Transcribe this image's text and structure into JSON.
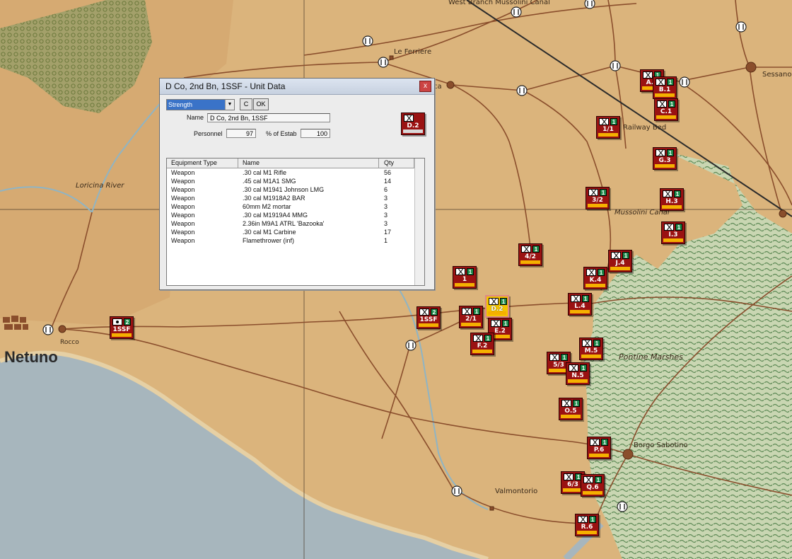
{
  "map": {
    "colors": {
      "land": "#dcb37a",
      "sea": "#a9b8c2",
      "marsh": "#c7d6b8",
      "road": "#8b4f2e",
      "river": "#8eb5c7",
      "forest": "#9aa36a"
    },
    "labels": {
      "west_branch": "West Branch Mussolini Canal",
      "le_ferriere": "Le Ferriere",
      "sessano": "Sessano",
      "railway_bed": "Railway Bed",
      "loricina": "Loricina River",
      "mussolini_canal": "Mussolini Canal",
      "pontine": "Pontine Marshes",
      "borgo": "Borgo Sabotino",
      "valmontorio": "Valmontorio",
      "rocco": "Rocco",
      "netuno": "Netuno",
      "cisterna_fragment": "ca"
    }
  },
  "units": [
    {
      "id": "a1",
      "label": "A.1",
      "num": "1",
      "icon": "infantry-icon"
    },
    {
      "id": "b1",
      "label": "B.1",
      "num": "1",
      "icon": "infantry-icon"
    },
    {
      "id": "c1",
      "label": "C.1",
      "num": "1",
      "icon": "infantry-icon"
    },
    {
      "id": "u1_1",
      "label": "1/1",
      "num": "1",
      "icon": "infantry-icon"
    },
    {
      "id": "g3",
      "label": "G.3",
      "num": "1",
      "icon": "infantry-icon"
    },
    {
      "id": "h3",
      "label": "H.3",
      "num": "1",
      "icon": "infantry-icon"
    },
    {
      "id": "u3_2",
      "label": "3/2",
      "num": "1",
      "icon": "infantry-icon"
    },
    {
      "id": "i3",
      "label": "I.3",
      "num": "1",
      "icon": "infantry-icon"
    },
    {
      "id": "u4_2",
      "label": "4/2",
      "num": "1",
      "icon": "infantry-icon"
    },
    {
      "id": "j4",
      "label": "J.4",
      "num": "1",
      "icon": "infantry-icon"
    },
    {
      "id": "k4",
      "label": "K.4",
      "num": "1",
      "icon": "infantry-icon"
    },
    {
      "id": "u1",
      "label": "1",
      "num": "1",
      "icon": "infantry-icon"
    },
    {
      "id": "l4",
      "label": "L.4",
      "num": "1",
      "icon": "infantry-icon"
    },
    {
      "id": "d2",
      "label": "D.2",
      "num": "1",
      "icon": "infantry-icon"
    },
    {
      "id": "s1ssf2",
      "label": "1SSF",
      "num": "2",
      "icon": "infantry-icon"
    },
    {
      "id": "u2_1",
      "label": "2/1",
      "num": "1",
      "icon": "infantry-icon"
    },
    {
      "id": "e2",
      "label": "E.2",
      "num": "1",
      "icon": "infantry-icon"
    },
    {
      "id": "f2",
      "label": "F.2",
      "num": "1",
      "icon": "infantry-icon"
    },
    {
      "id": "m5",
      "label": "M.5",
      "num": "1",
      "icon": "infantry-icon"
    },
    {
      "id": "u5_3",
      "label": "5/3",
      "num": "1",
      "icon": "infantry-icon"
    },
    {
      "id": "n5",
      "label": "N.5",
      "num": "1",
      "icon": "infantry-icon"
    },
    {
      "id": "o5",
      "label": "O.5",
      "num": "1",
      "icon": "infantry-icon"
    },
    {
      "id": "p6",
      "label": "P.6",
      "num": "1",
      "icon": "infantry-icon"
    },
    {
      "id": "u6_3",
      "label": "6/3",
      "num": "1",
      "icon": "infantry-icon"
    },
    {
      "id": "q6",
      "label": "Q.6",
      "num": "1",
      "icon": "infantry-icon"
    },
    {
      "id": "r6",
      "label": "R.6",
      "num": "1",
      "icon": "infantry-icon"
    },
    {
      "id": "hq1ssf",
      "label": "1SSF",
      "num": "2",
      "icon": "hq-icon"
    }
  ],
  "dialog": {
    "title": "D Co, 2nd Bn, 1SSF - Unit Data",
    "close_label": "x",
    "view_select": "Strength",
    "c_button": "C",
    "ok_button": "OK",
    "name_label": "Name",
    "name_value": "D Co, 2nd Bn, 1SSF",
    "personnel_label": "Personnel",
    "personnel_value": "97",
    "estab_label": "% of Estab",
    "estab_value": "100",
    "counter_label": "D.2",
    "table": {
      "headers": [
        "Equipment Type",
        "Name",
        "Qty"
      ],
      "rows": [
        {
          "type": "Weapon",
          "name": ".30 cal M1 Rifle",
          "qty": "56"
        },
        {
          "type": "Weapon",
          "name": ".45 cal M1A1 SMG",
          "qty": "14"
        },
        {
          "type": "Weapon",
          "name": ".30 cal M1941 Johnson LMG",
          "qty": "6"
        },
        {
          "type": "Weapon",
          "name": ".30 cal M1918A2 BAR",
          "qty": "3"
        },
        {
          "type": "Weapon",
          "name": "60mm M2 mortar",
          "qty": "3"
        },
        {
          "type": "Weapon",
          "name": ".30 cal M1919A4 MMG",
          "qty": "3"
        },
        {
          "type": "Weapon",
          "name": "2.36in M9A1 ATRL 'Bazooka'",
          "qty": "3"
        },
        {
          "type": "Weapon",
          "name": ".30 cal M1 Carbine",
          "qty": "17"
        },
        {
          "type": "Weapon",
          "name": "Flamethrower (inf)",
          "qty": "1"
        }
      ]
    }
  }
}
